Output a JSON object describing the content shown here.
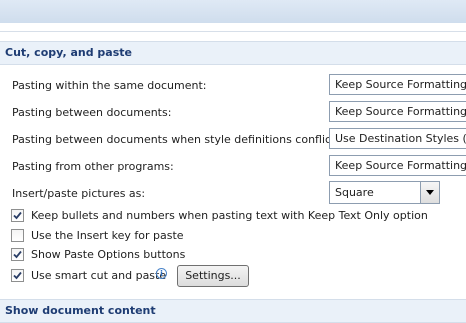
{
  "section1": {
    "title": "Cut, copy, and paste"
  },
  "rows": [
    {
      "label": "Pasting within the same document:",
      "value": "Keep Source Formatting (Default)"
    },
    {
      "label": "Pasting between documents:",
      "value": "Keep Source Formatting (Default)"
    },
    {
      "label": "Pasting between documents when style definitions conflict:",
      "value": "Use Destination Styles (Default)"
    },
    {
      "label": "Pasting from other programs:",
      "value": "Keep Source Formatting (Default)"
    }
  ],
  "pictures": {
    "label": "Insert/paste pictures as:",
    "value": "Square"
  },
  "checkboxes": [
    {
      "label": "Keep bullets and numbers when pasting text with Keep Text Only option",
      "checked": true
    },
    {
      "label": "Use the Insert key for paste",
      "checked": false
    },
    {
      "label": "Show Paste Options buttons",
      "checked": true
    },
    {
      "label": "Use smart cut and paste",
      "checked": true
    }
  ],
  "settings_button": {
    "label": "Settings..."
  },
  "section2": {
    "title": "Show document content"
  }
}
